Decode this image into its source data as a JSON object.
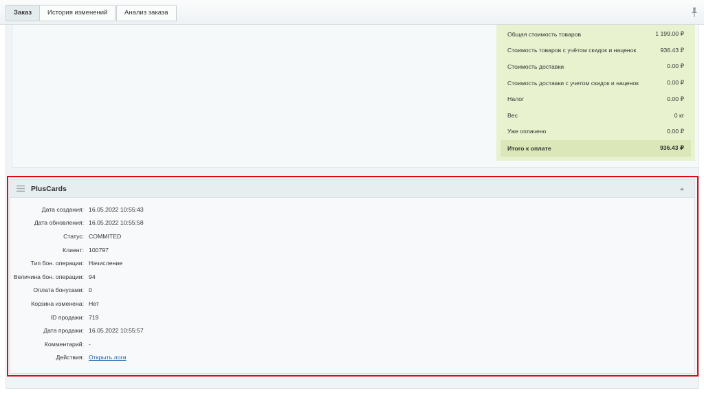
{
  "tabs": [
    {
      "label": "Заказ",
      "active": true
    },
    {
      "label": "История изменений",
      "active": false
    },
    {
      "label": "Анализ заказа",
      "active": false
    }
  ],
  "totals": {
    "rows": [
      {
        "label": "Общая стоимость товаров",
        "value": "1 199.00 ₽"
      },
      {
        "label": "Стоимость товаров с учётом скидок и наценок",
        "value": "936.43 ₽"
      },
      {
        "label": "Стоимость доставки",
        "value": "0.00 ₽"
      },
      {
        "label": "Стоимость доставки с учетом скидок и наценок",
        "value": "0.00 ₽"
      },
      {
        "label": "Налог",
        "value": "0.00 ₽"
      },
      {
        "label": "Вес",
        "value": "0 кг"
      },
      {
        "label": "Уже оплачено",
        "value": "0.00 ₽"
      }
    ],
    "total": {
      "label": "Итого к оплате",
      "value": "936.43 ₽"
    }
  },
  "pluscards": {
    "title": "PlusCards",
    "fields": [
      {
        "label": "Дата создания:",
        "value": "16.05.2022 10:55:43"
      },
      {
        "label": "Дата обновления:",
        "value": "16.05.2022 10:55:58"
      },
      {
        "label": "Статус:",
        "value": "COMMITED"
      },
      {
        "label": "Клиент:",
        "value": "100797"
      },
      {
        "label": "Тип бон. операции:",
        "value": "Начисление"
      },
      {
        "label": "Величина бон. операции:",
        "value": "94"
      },
      {
        "label": "Оплата бонусами:",
        "value": "0"
      },
      {
        "label": "Корзина изменена:",
        "value": "Нет"
      },
      {
        "label": "ID продажи:",
        "value": "719"
      },
      {
        "label": "Дата продажи:",
        "value": "16.05.2022 10:55:57"
      },
      {
        "label": "Комментарий:",
        "value": "-"
      }
    ],
    "actions": {
      "label": "Действия:",
      "link": "Открыть логи"
    }
  },
  "colors": {
    "highlight_border": "#e30613",
    "totals_bg": "#e9f2cf",
    "link": "#2067b0"
  },
  "icons": [
    "pin-icon",
    "menu-icon",
    "collapse-up-icon"
  ]
}
